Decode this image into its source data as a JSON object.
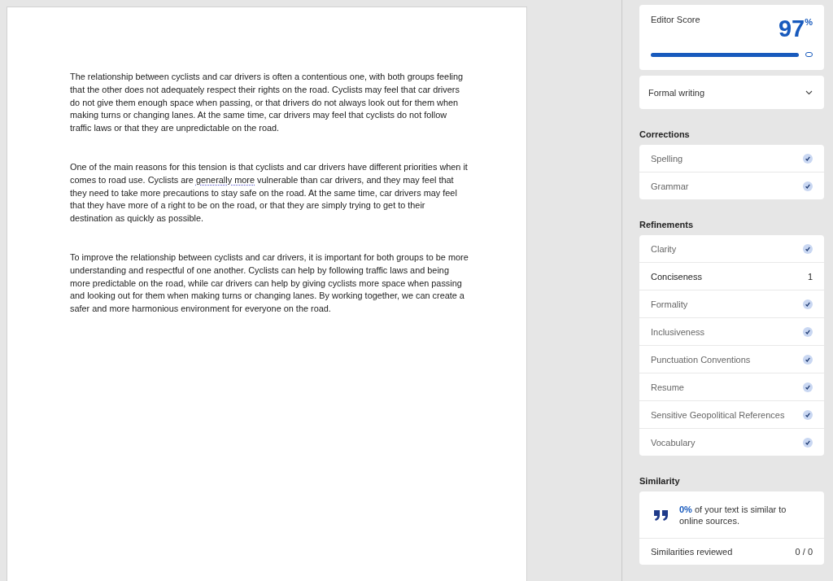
{
  "document": {
    "paragraphs": [
      {
        "segments": [
          {
            "text": "The relationship between cyclists and car drivers is often a contentious one, with both groups feeling that the other does not adequately respect their rights on the road. Cyclists may feel that car drivers do not give them enough space when passing, or that drivers do not always look out for them when making turns or changing lanes. At the same time, car drivers may feel that cyclists do not follow traffic laws or that they are unpredictable on the road.",
            "flagged": false
          }
        ]
      },
      {
        "segments": [
          {
            "text": "One of the main reasons for this tension is that cyclists and car drivers have different priorities when it comes to road use. Cyclists are ",
            "flagged": false
          },
          {
            "text": "generally more",
            "flagged": true
          },
          {
            "text": " vulnerable than car drivers, and they may feel that they need to take more precautions to stay safe on the road. At the same time, car drivers may feel that they have more of a right to be on the road, or that they are simply trying to get to their destination as quickly as possible.",
            "flagged": false
          }
        ]
      },
      {
        "segments": [
          {
            "text": "To improve the relationship between cyclists and car drivers, it is important for both groups to be more understanding and respectful of one another. Cyclists can help by following traffic laws and being more predictable on the road, while car drivers can help by giving cyclists more space when passing and looking out for them when making turns or changing lanes. By working together, we can create a safer and more harmonious environment for everyone on the road.",
            "flagged": false
          }
        ]
      }
    ]
  },
  "editor": {
    "score": {
      "label": "Editor Score",
      "value": "97",
      "unit": "%",
      "level": 0.97
    },
    "style_dropdown": {
      "value": "Formal writing"
    },
    "sections": [
      {
        "title": "Corrections",
        "items": [
          {
            "label": "Spelling",
            "kind": "check"
          },
          {
            "label": "Grammar",
            "kind": "check"
          }
        ]
      },
      {
        "title": "Refinements",
        "items": [
          {
            "label": "Clarity",
            "kind": "check"
          },
          {
            "label": "Conciseness",
            "kind": "count",
            "count": "1"
          },
          {
            "label": "Formality",
            "kind": "check"
          },
          {
            "label": "Inclusiveness",
            "kind": "check"
          },
          {
            "label": "Punctuation Conventions",
            "kind": "check"
          },
          {
            "label": "Resume",
            "kind": "check"
          },
          {
            "label": "Sensitive Geopolitical References",
            "kind": "check"
          },
          {
            "label": "Vocabulary",
            "kind": "check"
          }
        ]
      }
    ],
    "similarity": {
      "title": "Similarity",
      "message": "**0%** of your text is similar to online sources.",
      "reviewed_label": "Similarities reviewed",
      "reviewed_value": "0 / 0"
    }
  }
}
